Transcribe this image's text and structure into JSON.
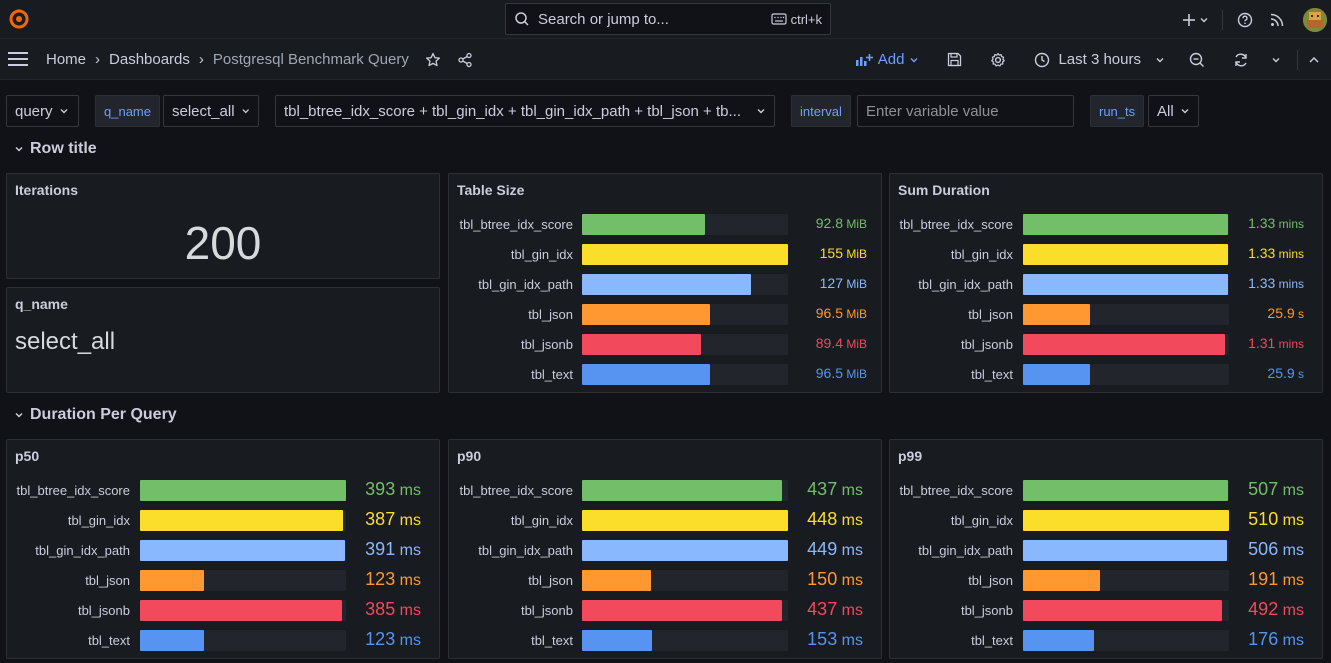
{
  "topbar": {
    "search_placeholder": "Search or jump to...",
    "shortcut": "ctrl+k"
  },
  "nav": {
    "breadcrumb": [
      "Home",
      "Dashboards",
      "Postgresql Benchmark Query"
    ],
    "add_label": "Add",
    "time_range": "Last 3 hours"
  },
  "variables": {
    "query_label": "query",
    "q_name_label": "q_name",
    "q_name_value": "select_all",
    "tables_value": "tbl_btree_idx_score + tbl_gin_idx + tbl_gin_idx_path + tbl_json + tb...",
    "interval_label": "interval",
    "interval_placeholder": "Enter variable value",
    "run_ts_label": "run_ts",
    "run_ts_value": "All"
  },
  "rows": {
    "row1_title": "Row title",
    "row2_title": "Duration Per Query"
  },
  "colors": {
    "green": "#73bf69",
    "yellow": "#fade2a",
    "lightblue": "#8ab8ff",
    "orange": "#ff9830",
    "red": "#f2495c",
    "blue": "#5794f2"
  },
  "panels": {
    "iterations": {
      "title": "Iterations",
      "value": "200"
    },
    "q_name": {
      "title": "q_name",
      "value": "select_all"
    },
    "table_size": {
      "title": "Table Size",
      "max": 155,
      "items": [
        {
          "label": "tbl_btree_idx_score",
          "value": 92.8,
          "num": "92.8",
          "unit": " MiB",
          "color": "green"
        },
        {
          "label": "tbl_gin_idx",
          "value": 155,
          "num": "155",
          "unit": " MiB",
          "color": "yellow"
        },
        {
          "label": "tbl_gin_idx_path",
          "value": 127,
          "num": "127",
          "unit": " MiB",
          "color": "lightblue"
        },
        {
          "label": "tbl_json",
          "value": 96.5,
          "num": "96.5",
          "unit": " MiB",
          "color": "orange"
        },
        {
          "label": "tbl_jsonb",
          "value": 89.4,
          "num": "89.4",
          "unit": " MiB",
          "color": "red"
        },
        {
          "label": "tbl_text",
          "value": 96.5,
          "num": "96.5",
          "unit": " MiB",
          "color": "blue"
        }
      ]
    },
    "sum_duration": {
      "title": "Sum Duration",
      "max": 80,
      "items": [
        {
          "label": "tbl_btree_idx_score",
          "value": 79.8,
          "num": "1.33",
          "unit": " mins",
          "color": "green"
        },
        {
          "label": "tbl_gin_idx",
          "value": 79.8,
          "num": "1.33",
          "unit": " mins",
          "color": "yellow"
        },
        {
          "label": "tbl_gin_idx_path",
          "value": 79.8,
          "num": "1.33",
          "unit": " mins",
          "color": "lightblue"
        },
        {
          "label": "tbl_json",
          "value": 25.9,
          "num": "25.9",
          "unit": " s",
          "color": "orange"
        },
        {
          "label": "tbl_jsonb",
          "value": 78.6,
          "num": "1.31",
          "unit": " mins",
          "color": "red"
        },
        {
          "label": "tbl_text",
          "value": 25.9,
          "num": "25.9",
          "unit": " s",
          "color": "blue"
        }
      ]
    },
    "p50": {
      "title": "p50",
      "max": 393,
      "items": [
        {
          "label": "tbl_btree_idx_score",
          "value": 393,
          "num": "393",
          "unit": " ms",
          "color": "green"
        },
        {
          "label": "tbl_gin_idx",
          "value": 387,
          "num": "387",
          "unit": " ms",
          "color": "yellow"
        },
        {
          "label": "tbl_gin_idx_path",
          "value": 391,
          "num": "391",
          "unit": " ms",
          "color": "lightblue"
        },
        {
          "label": "tbl_json",
          "value": 123,
          "num": "123",
          "unit": " ms",
          "color": "orange"
        },
        {
          "label": "tbl_jsonb",
          "value": 385,
          "num": "385",
          "unit": " ms",
          "color": "red"
        },
        {
          "label": "tbl_text",
          "value": 123,
          "num": "123",
          "unit": " ms",
          "color": "blue"
        }
      ]
    },
    "p90": {
      "title": "p90",
      "max": 449,
      "items": [
        {
          "label": "tbl_btree_idx_score",
          "value": 437,
          "num": "437",
          "unit": " ms",
          "color": "green"
        },
        {
          "label": "tbl_gin_idx",
          "value": 448,
          "num": "448",
          "unit": " ms",
          "color": "yellow"
        },
        {
          "label": "tbl_gin_idx_path",
          "value": 449,
          "num": "449",
          "unit": " ms",
          "color": "lightblue"
        },
        {
          "label": "tbl_json",
          "value": 150,
          "num": "150",
          "unit": " ms",
          "color": "orange"
        },
        {
          "label": "tbl_jsonb",
          "value": 437,
          "num": "437",
          "unit": " ms",
          "color": "red"
        },
        {
          "label": "tbl_text",
          "value": 153,
          "num": "153",
          "unit": " ms",
          "color": "blue"
        }
      ]
    },
    "p99": {
      "title": "p99",
      "max": 510,
      "items": [
        {
          "label": "tbl_btree_idx_score",
          "value": 507,
          "num": "507",
          "unit": " ms",
          "color": "green"
        },
        {
          "label": "tbl_gin_idx",
          "value": 510,
          "num": "510",
          "unit": " ms",
          "color": "yellow"
        },
        {
          "label": "tbl_gin_idx_path",
          "value": 506,
          "num": "506",
          "unit": " ms",
          "color": "lightblue"
        },
        {
          "label": "tbl_json",
          "value": 191,
          "num": "191",
          "unit": " ms",
          "color": "orange"
        },
        {
          "label": "tbl_jsonb",
          "value": 492,
          "num": "492",
          "unit": " ms",
          "color": "red"
        },
        {
          "label": "tbl_text",
          "value": 176,
          "num": "176",
          "unit": " ms",
          "color": "blue"
        }
      ]
    }
  }
}
